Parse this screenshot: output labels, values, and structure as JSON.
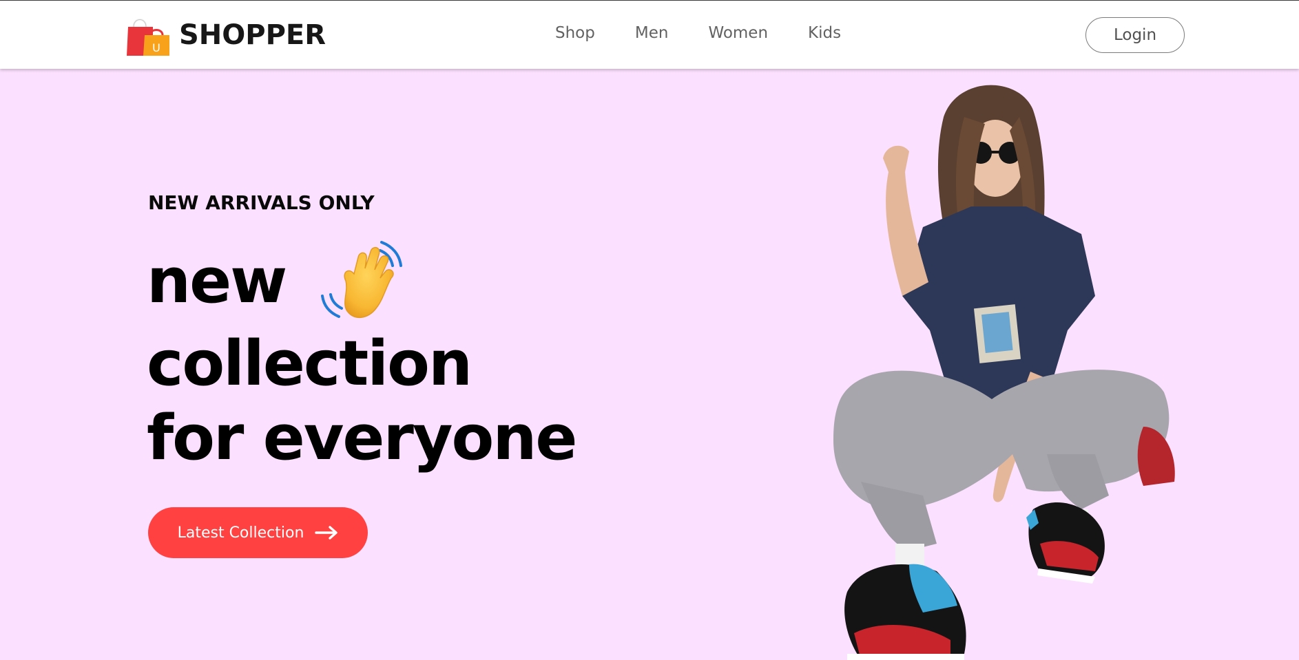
{
  "header": {
    "brand": "SHOPPER",
    "nav": [
      {
        "label": "Shop"
      },
      {
        "label": "Men"
      },
      {
        "label": "Women"
      },
      {
        "label": "Kids"
      }
    ],
    "login_label": "Login"
  },
  "hero": {
    "kicker": "NEW ARRIVALS ONLY",
    "headline_line1": "new",
    "headline_line2": "collection",
    "headline_line3": "for everyone",
    "headline_icon": "waving-hand-icon",
    "cta_label": "Latest Collection",
    "cta_icon": "arrow-right-icon",
    "image": "hero-model-image"
  },
  "colors": {
    "hero_background": "#fce0ff",
    "cta_background": "#ff4141",
    "brand_text": "#171717",
    "nav_text": "#626262"
  }
}
